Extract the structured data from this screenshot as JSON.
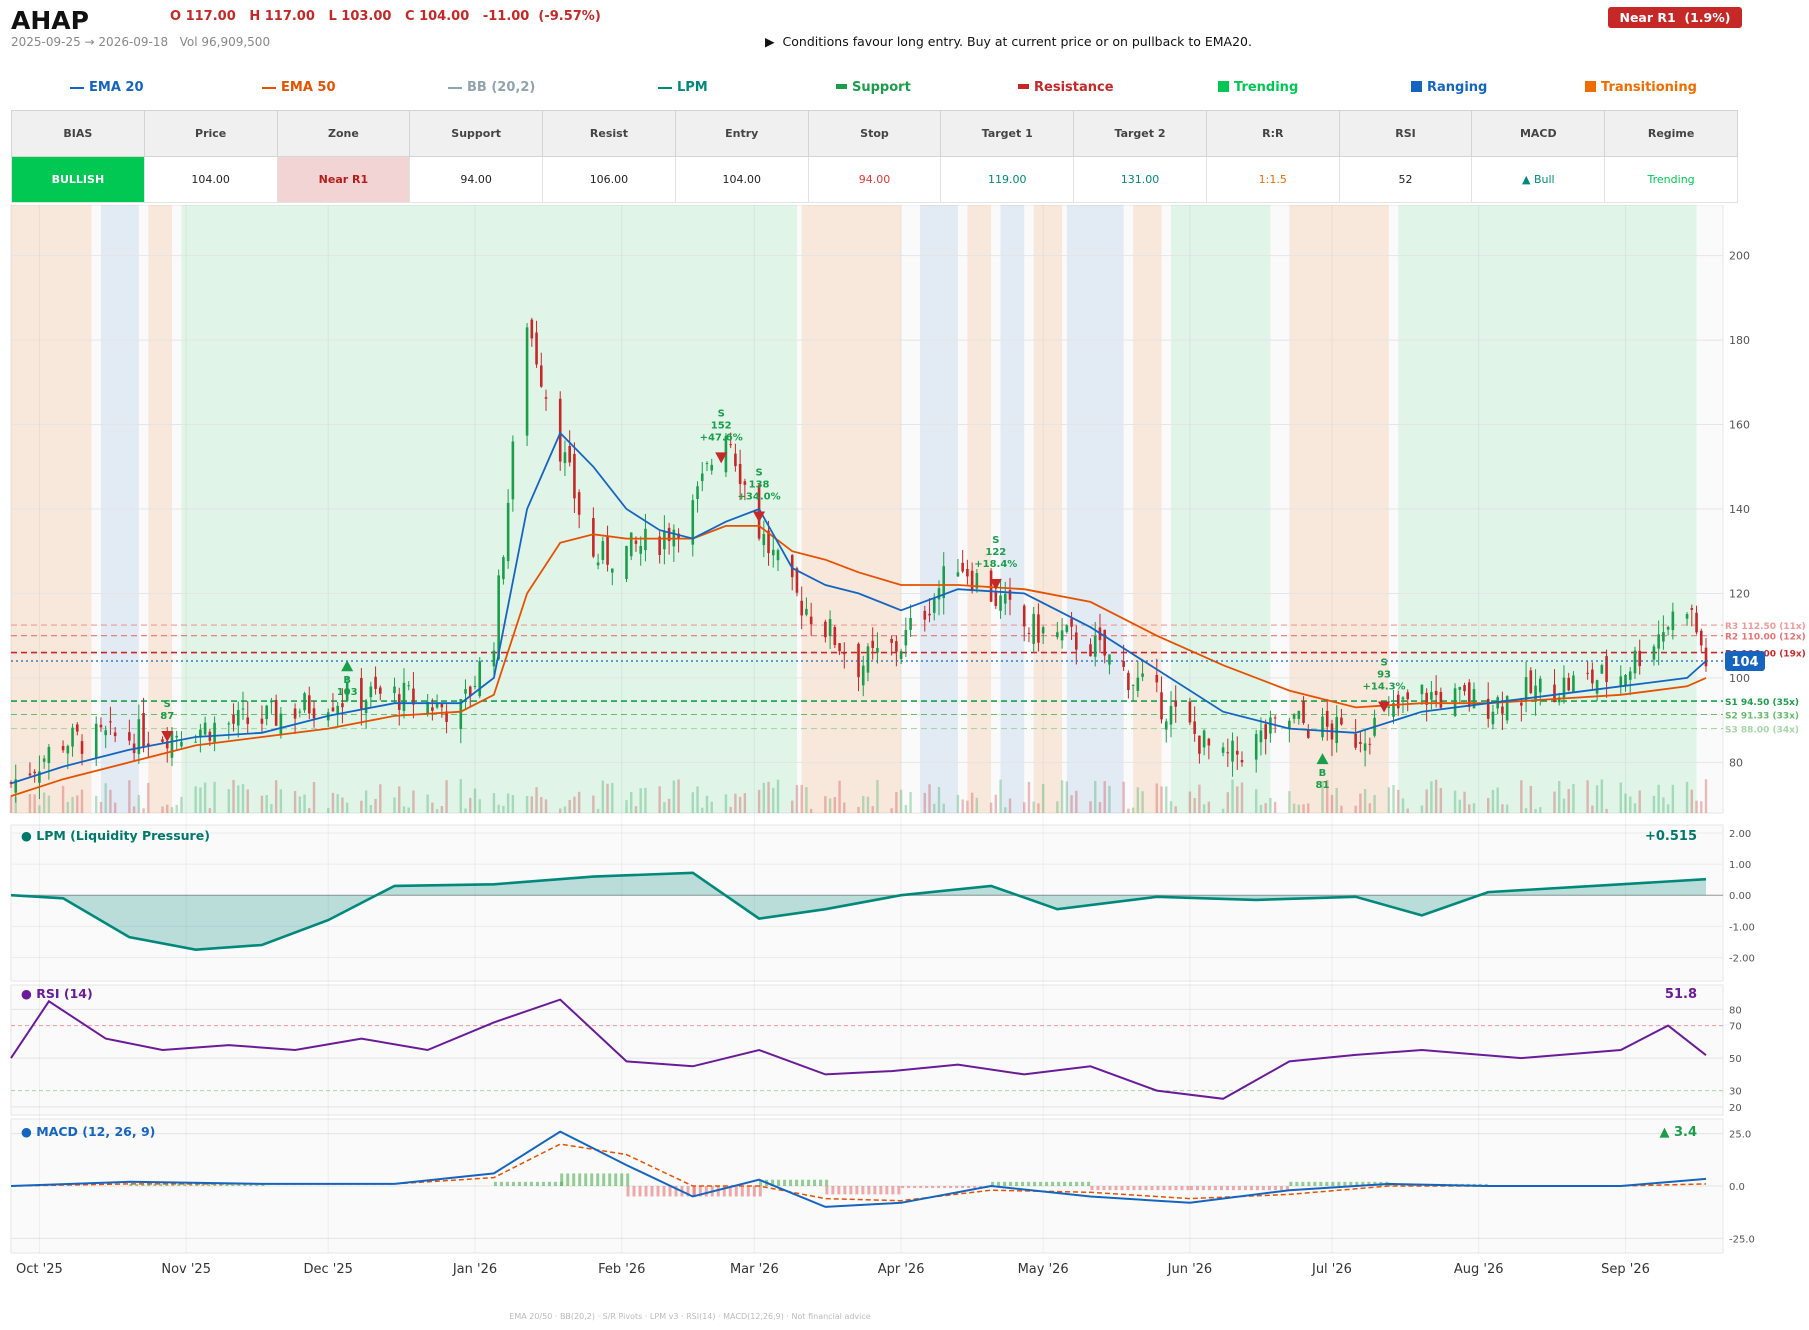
{
  "header": {
    "ticker": "AHAP",
    "ohlc": "O 117.00   H 117.00   L 103.00   C 104.00   -11.00  (-9.57%)",
    "range": "2025-09-25 → 2026-09-18   Vol 96,909,500",
    "advice": "▶  Conditions favour long entry. Buy at current price or on pullback to EMA20.",
    "badge": "Near R1  (1.9%)"
  },
  "legend": [
    {
      "label": "EMA 20",
      "color": "#1565c0",
      "kind": "line"
    },
    {
      "label": "EMA 50",
      "color": "#e65100",
      "kind": "line"
    },
    {
      "label": "BB (20,2)",
      "color": "#90a4ae",
      "kind": "line"
    },
    {
      "label": "LPM",
      "color": "#00897b",
      "kind": "line"
    },
    {
      "label": "Support",
      "color": "#1b9e4b",
      "kind": "bar"
    },
    {
      "label": "Resistance",
      "color": "#c62828",
      "kind": "bar"
    },
    {
      "label": "Trending",
      "color": "#00c853",
      "kind": "square"
    },
    {
      "label": "Ranging",
      "color": "#1565c0",
      "kind": "square"
    },
    {
      "label": "Transitioning",
      "color": "#ef6c00",
      "kind": "square"
    }
  ],
  "summary": {
    "headers": [
      "BIAS",
      "Price",
      "Zone",
      "Support",
      "Resist",
      "Entry",
      "Stop",
      "Target 1",
      "Target 2",
      "R:R",
      "RSI",
      "MACD",
      "Regime"
    ],
    "values": [
      "BULLISH",
      "104.00",
      "Near R1",
      "94.00",
      "106.00",
      "104.00",
      "94.00",
      "119.00",
      "131.00",
      "1:1.5",
      "52",
      "▲ Bull",
      "Trending"
    ],
    "value_colors": [
      "#ffffff",
      "#222222",
      "#b71c1c",
      "#222222",
      "#222222",
      "#222222",
      "#e53935",
      "#00897b",
      "#00897b",
      "#ef6c00",
      "#222222",
      "#00897b",
      "#00c853"
    ]
  },
  "chart_data": [
    {
      "type": "candlestick",
      "title": "AHAP",
      "x": [
        "2025-09-25",
        "2025-10-06",
        "2025-10-20",
        "2025-11-03",
        "2025-11-17",
        "2025-12-01",
        "2025-12-15",
        "2025-12-29",
        "2026-01-05",
        "2026-01-12",
        "2026-01-19",
        "2026-01-26",
        "2026-02-02",
        "2026-02-09",
        "2026-02-16",
        "2026-02-23",
        "2026-03-02",
        "2026-03-09",
        "2026-03-16",
        "2026-03-23",
        "2026-04-01",
        "2026-04-13",
        "2026-04-27",
        "2026-05-11",
        "2026-05-25",
        "2026-06-08",
        "2026-06-22",
        "2026-07-06",
        "2026-07-20",
        "2026-08-03",
        "2026-08-17",
        "2026-08-31",
        "2026-09-14",
        "2026-09-18"
      ],
      "close": [
        75,
        85,
        86,
        88,
        90,
        95,
        96,
        92,
        110,
        185,
        155,
        128,
        130,
        133,
        140,
        160,
        135,
        120,
        112,
        103,
        108,
        128,
        112,
        108,
        95,
        80,
        90,
        86,
        96,
        94,
        98,
        101,
        118,
        104
      ],
      "ema20": [
        75,
        79,
        83,
        86,
        87,
        91,
        94,
        94,
        100,
        140,
        158,
        150,
        140,
        135,
        133,
        137,
        140,
        126,
        122,
        120,
        116,
        121,
        120,
        112,
        102,
        92,
        88,
        87,
        92,
        94,
        96,
        98,
        100,
        104
      ],
      "ema50": [
        72,
        76,
        80,
        84,
        86,
        88,
        91,
        92,
        96,
        120,
        132,
        134,
        133,
        133,
        133,
        136,
        136,
        130,
        128,
        125,
        122,
        122,
        121,
        118,
        110,
        103,
        97,
        93,
        94,
        94,
        95,
        96,
        98,
        100
      ],
      "yticks": [
        80,
        100,
        120,
        140,
        160,
        180,
        200
      ],
      "ylim": [
        68,
        212
      ],
      "xticks": [
        "Oct '25",
        "Nov '25",
        "Dec '25",
        "Jan '26",
        "Feb '26",
        "Mar '26",
        "Apr '26",
        "May '26",
        "Jun '26",
        "Jul '26",
        "Aug '26",
        "Sep '26"
      ],
      "levels": [
        {
          "label": "R3 112.50 (11x)",
          "value": 112.5,
          "color": "#ef9a9a"
        },
        {
          "label": "R2 110.00 (12x)",
          "value": 110.0,
          "color": "#e57373"
        },
        {
          "label": "R1 106.00 (19x)",
          "value": 106.0,
          "color": "#c62828"
        },
        {
          "label": "S1 94.50 (35x)",
          "value": 94.5,
          "color": "#1b9e4b"
        },
        {
          "label": "S2 91.33 (33x)",
          "value": 91.33,
          "color": "#66bb6a"
        },
        {
          "label": "S3 88.00 (34x)",
          "value": 88.0,
          "color": "#a5d6a7"
        }
      ],
      "price_label": "104",
      "signals": [
        {
          "side": "S",
          "date": "2025-10-28",
          "price": 86,
          "text": [
            "S",
            "87"
          ]
        },
        {
          "side": "B",
          "date": "2025-12-05",
          "price": 103,
          "text": [
            "B",
            "103"
          ]
        },
        {
          "side": "S",
          "date": "2026-02-22",
          "price": 152,
          "text": [
            "S",
            "152",
            "+47.6%"
          ]
        },
        {
          "side": "S",
          "date": "2026-03-02",
          "price": 138,
          "text": [
            "S",
            "138",
            "+34.0%"
          ]
        },
        {
          "side": "S",
          "date": "2026-04-21",
          "price": 122,
          "text": [
            "S",
            "122",
            "+18.4%"
          ]
        },
        {
          "side": "B",
          "date": "2026-06-29",
          "price": 81,
          "text": [
            "B",
            "81"
          ]
        },
        {
          "side": "S",
          "date": "2026-07-12",
          "price": 93,
          "text": [
            "S",
            "93",
            "+14.3%"
          ]
        }
      ],
      "regimes": [
        {
          "from": "2025-09-25",
          "to": "2025-10-12",
          "kind": "Transitioning"
        },
        {
          "from": "2025-10-14",
          "to": "2025-10-22",
          "kind": "Ranging"
        },
        {
          "from": "2025-10-24",
          "to": "2025-10-29",
          "kind": "Transitioning"
        },
        {
          "from": "2025-10-31",
          "to": "2026-03-10",
          "kind": "Trending"
        },
        {
          "from": "2026-03-11",
          "to": "2026-04-01",
          "kind": "Transitioning"
        },
        {
          "from": "2026-04-05",
          "to": "2026-04-13",
          "kind": "Ranging"
        },
        {
          "from": "2026-04-15",
          "to": "2026-04-20",
          "kind": "Transitioning"
        },
        {
          "from": "2026-04-22",
          "to": "2026-04-27",
          "kind": "Ranging"
        },
        {
          "from": "2026-04-29",
          "to": "2026-05-05",
          "kind": "Transitioning"
        },
        {
          "from": "2026-05-06",
          "to": "2026-05-18",
          "kind": "Ranging"
        },
        {
          "from": "2026-05-20",
          "to": "2026-05-26",
          "kind": "Transitioning"
        },
        {
          "from": "2026-05-28",
          "to": "2026-06-18",
          "kind": "Trending"
        },
        {
          "from": "2026-06-22",
          "to": "2026-07-13",
          "kind": "Transitioning"
        },
        {
          "from": "2026-07-15",
          "to": "2026-09-16",
          "kind": "Trending"
        }
      ]
    },
    {
      "type": "area",
      "title": "LPM (Liquidity Pressure)",
      "value_label": "+0.515",
      "x": [
        "2025-09-25",
        "2025-10-06",
        "2025-10-20",
        "2025-11-03",
        "2025-11-17",
        "2025-12-01",
        "2025-12-15",
        "2026-01-05",
        "2026-01-26",
        "2026-02-16",
        "2026-03-02",
        "2026-03-16",
        "2026-04-01",
        "2026-04-20",
        "2026-05-04",
        "2026-05-25",
        "2026-06-15",
        "2026-07-06",
        "2026-07-20",
        "2026-08-03",
        "2026-08-31",
        "2026-09-18"
      ],
      "values": [
        0.0,
        -0.1,
        -1.35,
        -1.75,
        -1.6,
        -0.8,
        0.3,
        0.35,
        0.6,
        0.72,
        -0.75,
        -0.45,
        0.0,
        0.3,
        -0.45,
        -0.05,
        -0.15,
        -0.05,
        -0.65,
        0.1,
        0.35,
        0.515
      ],
      "yticks": [
        "2.00",
        "1.00",
        "0.00",
        "-1.00",
        "-2.00"
      ],
      "ylim": [
        -2.5,
        2.0
      ]
    },
    {
      "type": "line",
      "title": "RSI (14)",
      "value_label": "51.8",
      "x": [
        "2025-09-25",
        "2025-10-03",
        "2025-10-15",
        "2025-10-27",
        "2025-11-10",
        "2025-11-24",
        "2025-12-08",
        "2025-12-22",
        "2026-01-05",
        "2026-01-19",
        "2026-02-02",
        "2026-02-16",
        "2026-03-02",
        "2026-03-16",
        "2026-03-30",
        "2026-04-13",
        "2026-04-27",
        "2026-05-11",
        "2026-05-25",
        "2026-06-08",
        "2026-06-22",
        "2026-07-06",
        "2026-07-20",
        "2026-08-10",
        "2026-08-31",
        "2026-09-10",
        "2026-09-18"
      ],
      "values": [
        50,
        85,
        62,
        55,
        58,
        55,
        62,
        55,
        72,
        86,
        48,
        45,
        55,
        40,
        42,
        46,
        40,
        45,
        30,
        25,
        48,
        52,
        55,
        50,
        55,
        70,
        51.8
      ],
      "yticks": [
        80,
        70,
        50,
        30,
        20
      ],
      "ylim": [
        15,
        95
      ]
    },
    {
      "type": "line",
      "title": "MACD (12, 26, 9)",
      "value_label": "▲ 3.4",
      "x": [
        "2025-09-25",
        "2025-10-20",
        "2025-11-17",
        "2025-12-15",
        "2026-01-05",
        "2026-01-19",
        "2026-02-02",
        "2026-02-16",
        "2026-03-02",
        "2026-03-16",
        "2026-04-01",
        "2026-04-20",
        "2026-05-11",
        "2026-06-01",
        "2026-06-22",
        "2026-07-13",
        "2026-08-03",
        "2026-08-31",
        "2026-09-18"
      ],
      "series": [
        {
          "name": "MACD",
          "values": [
            0,
            2,
            1,
            1,
            6,
            26,
            10,
            -5,
            3,
            -10,
            -8,
            0,
            -5,
            -8,
            -2,
            1,
            0,
            0,
            3.4
          ]
        },
        {
          "name": "Signal",
          "values": [
            0,
            1,
            1,
            1,
            4,
            20,
            15,
            0,
            0,
            -6,
            -7,
            -2,
            -3,
            -6,
            -4,
            0,
            0,
            0,
            1
          ]
        }
      ],
      "yticks": [
        "25.0",
        "0.0",
        "-25.0"
      ],
      "ylim": [
        -32,
        32
      ]
    }
  ],
  "footer": "EMA 20/50  ·  BB(20,2)  ·  S/R Pivots  ·  LPM v3  ·  RSI(14)  ·  MACD(12,26,9)  ·  Not financial advice"
}
